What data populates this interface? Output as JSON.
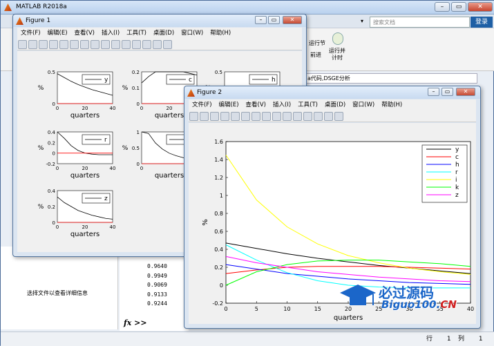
{
  "main_window": {
    "title": "MATLAB R2018a",
    "search_placeholder": "搜索文档",
    "login": "登录",
    "ribbon_run_section": "运行节",
    "ribbon_advance": "前进",
    "ribbon_run_time": "运行并\n计时",
    "current_path": "a代码,DSGE分析",
    "detail_text": "选择文件以查看详细信息",
    "cmd_values": [
      "0.9640",
      "0.9949",
      "0.9069",
      "0.9133",
      "0.9244"
    ],
    "cmd_prompt": "fx >>",
    "status_row_label": "行",
    "status_row_value": "1",
    "status_col_label": "列",
    "status_col_value": "1"
  },
  "figure1": {
    "title": "Figure 1",
    "menu": [
      "文件(F)",
      "编辑(E)",
      "查看(V)",
      "插入(I)",
      "工具(T)",
      "桌面(D)",
      "窗口(W)",
      "帮助(H)"
    ],
    "xlabel": "quarters",
    "ylabel": "%",
    "subplots": [
      {
        "legend": "y",
        "yticks": [
          "0.5",
          "0"
        ],
        "xticks": [
          "0",
          "20",
          "40"
        ]
      },
      {
        "legend": "c",
        "yticks": [
          "0.2",
          "0.1",
          "0"
        ],
        "xticks": [
          "0",
          "20",
          "40"
        ]
      },
      {
        "legend": "h",
        "yticks": [
          "0.5",
          "0"
        ],
        "xticks": [
          "0"
        ]
      },
      {
        "legend": "r",
        "yticks": [
          "0.4",
          "0.2",
          "0",
          "-0.2"
        ],
        "xticks": [
          "0",
          "20",
          "40"
        ]
      },
      {
        "legend": "i",
        "yticks": [
          "1",
          "0.5",
          "0"
        ],
        "xticks": [
          "0"
        ]
      },
      {
        "legend": "z",
        "yticks": [
          "0.4",
          "0.2",
          "0"
        ],
        "xticks": [
          "0",
          "20",
          "40"
        ]
      }
    ]
  },
  "figure2": {
    "title": "Figure 2",
    "menu": [
      "文件(F)",
      "编辑(E)",
      "查看(V)",
      "插入(I)",
      "工具(T)",
      "桌面(D)",
      "窗口(W)",
      "帮助(H)"
    ]
  },
  "chart_data": {
    "type": "line",
    "xlabel": "quarters",
    "ylabel": "%",
    "xlim": [
      0,
      40
    ],
    "ylim": [
      -0.2,
      1.6
    ],
    "xticks": [
      0,
      5,
      10,
      15,
      20,
      25,
      30,
      35,
      40
    ],
    "yticks": [
      -0.2,
      0,
      0.2,
      0.4,
      0.6,
      0.8,
      1,
      1.2,
      1.4,
      1.6
    ],
    "legend_position": "top-right",
    "x": [
      0,
      5,
      10,
      15,
      20,
      25,
      30,
      35,
      40
    ],
    "series": [
      {
        "name": "y",
        "color": "#000000",
        "values": [
          0.47,
          0.41,
          0.35,
          0.3,
          0.26,
          0.22,
          0.19,
          0.16,
          0.13
        ]
      },
      {
        "name": "c",
        "color": "#ff0000",
        "values": [
          0.13,
          0.17,
          0.2,
          0.21,
          0.21,
          0.21,
          0.2,
          0.19,
          0.18
        ]
      },
      {
        "name": "h",
        "color": "#0000ff",
        "values": [
          0.23,
          0.18,
          0.13,
          0.1,
          0.07,
          0.05,
          0.03,
          0.02,
          0.01
        ]
      },
      {
        "name": "r",
        "color": "#00ffff",
        "values": [
          0.45,
          0.28,
          0.14,
          0.05,
          0.0,
          -0.02,
          -0.03,
          -0.03,
          -0.03
        ]
      },
      {
        "name": "i",
        "color": "#ffff00",
        "values": [
          1.45,
          0.95,
          0.65,
          0.46,
          0.33,
          0.25,
          0.19,
          0.15,
          0.12
        ]
      },
      {
        "name": "k",
        "color": "#00ff00",
        "values": [
          0.0,
          0.15,
          0.23,
          0.27,
          0.28,
          0.28,
          0.26,
          0.24,
          0.21
        ]
      },
      {
        "name": "z",
        "color": "#ff00ff",
        "values": [
          0.32,
          0.25,
          0.2,
          0.15,
          0.12,
          0.09,
          0.07,
          0.05,
          0.04
        ]
      }
    ]
  },
  "watermark": {
    "text": "必过源码",
    "url_main": "Biguo100.",
    "url_tld": "CN"
  }
}
